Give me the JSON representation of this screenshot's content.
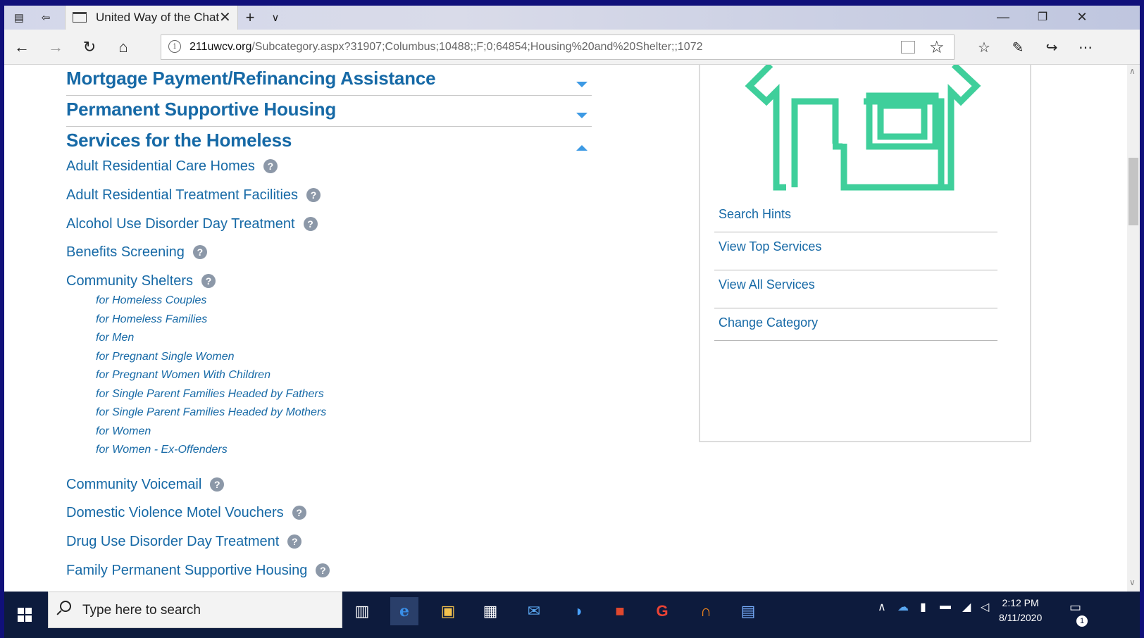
{
  "browser": {
    "tab_title": "United Way of the Chat",
    "url_domain": "211uwcv.org",
    "url_path": "/Subcategory.aspx?31907;Columbus;10488;;F;0;64854;Housing%20and%20Shelter;;1072"
  },
  "categories": [
    {
      "label": "Mortgage Payment/Refinancing Assistance",
      "expanded": false
    },
    {
      "label": "Permanent Supportive Housing",
      "expanded": false
    },
    {
      "label": "Services for the Homeless",
      "expanded": true
    }
  ],
  "services": [
    "Adult Residential Care Homes",
    "Adult Residential Treatment Facilities",
    "Alcohol Use Disorder Day Treatment",
    "Benefits Screening",
    "Community Shelters",
    "Community Voicemail",
    "Domestic Violence Motel Vouchers",
    "Drug Use Disorder Day Treatment",
    "Family Permanent Supportive Housing"
  ],
  "shelter_subitems": [
    "for Homeless Couples",
    "for Homeless Families",
    "for Men",
    "for Pregnant Single Women",
    "for Pregnant Women With Children",
    "for Single Parent Families Headed by Fathers",
    "for Single Parent Families Headed by Mothers",
    "for Women",
    "for Women - Ex-Offenders"
  ],
  "help_glyph": "?",
  "sidebar_links": [
    "Search Hints",
    "View Top Services",
    "View All Services",
    "Change Category"
  ],
  "taskbar": {
    "search_placeholder": "Type here to search",
    "time": "2:12 PM",
    "date": "8/11/2020",
    "notification_count": "1"
  },
  "colors": {
    "link": "#1669a6",
    "house_icon": "#3fcf9b",
    "caret": "#3d9ae4"
  },
  "icons": [
    "tab-list-icon",
    "back-tab-icon",
    "back-icon",
    "forward-icon",
    "refresh-icon",
    "home-icon",
    "info-icon",
    "reading-view-icon",
    "favorite-star-icon",
    "favorites-hub-icon",
    "pen-icon",
    "share-icon",
    "more-icon",
    "house-icon"
  ]
}
